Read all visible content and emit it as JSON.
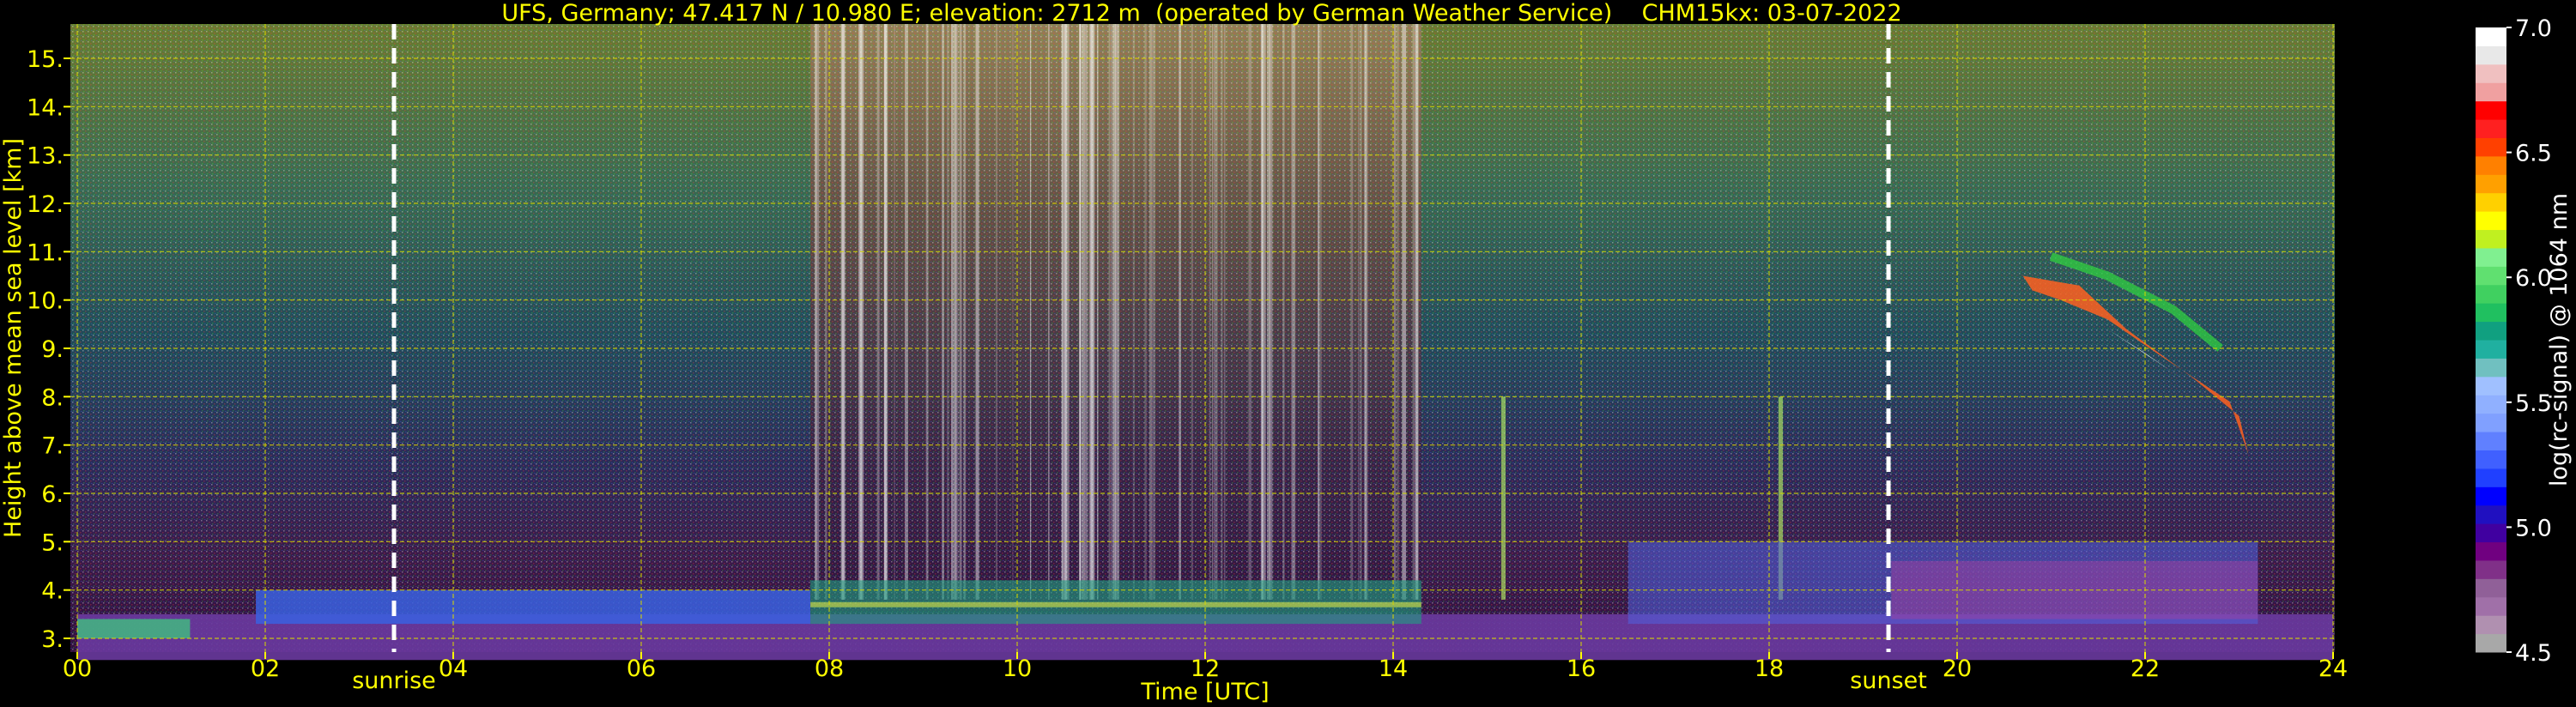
{
  "chart_data": {
    "type": "heatmap",
    "title": "UFS, Germany; 47.417 N / 10.980 E; elevation: 2712 m  (operated by German Weather Service)    CHM15kx: 03-07-2022",
    "xlabel": "Time [UTC]",
    "ylabel": "Height above mean sea level [km]",
    "xlim": [
      0,
      24
    ],
    "ylim": [
      2.8,
      15.7
    ],
    "x_ticks": [
      0,
      2,
      4,
      6,
      8,
      10,
      12,
      14,
      16,
      18,
      20,
      22,
      24
    ],
    "x_tick_labels": [
      "00",
      "02",
      "04",
      "06",
      "08",
      "10",
      "12",
      "14",
      "16",
      "18",
      "20",
      "22",
      "24"
    ],
    "y_ticks": [
      3,
      4,
      5,
      6,
      7,
      8,
      9,
      10,
      11,
      12,
      13,
      14,
      15
    ],
    "y_tick_labels": [
      "3.",
      "4.",
      "5.",
      "6.",
      "7.",
      "8.",
      "9.",
      "10.",
      "11.",
      "12.",
      "13.",
      "14.",
      "15."
    ],
    "grid": true,
    "markers": [
      {
        "label": "sunrise",
        "x": 3.37
      },
      {
        "label": "sunset",
        "x": 19.27
      }
    ],
    "colorbar": {
      "label": "log(rc-signal) @ 1064 nm",
      "range": [
        4.5,
        7.0
      ],
      "ticks": [
        4.5,
        5.0,
        5.5,
        6.0,
        6.5,
        7.0
      ],
      "tick_labels": [
        "4.5",
        "5.0",
        "5.5",
        "6.0",
        "6.5",
        "7.0"
      ],
      "colors": [
        "#a8a8a8",
        "#b090b0",
        "#a070a8",
        "#906098",
        "#803088",
        "#700080",
        "#4000a0",
        "#2010c0",
        "#0000ff",
        "#2040ff",
        "#4060ff",
        "#6080ff",
        "#80a0ff",
        "#90b0ff",
        "#a0c0ff",
        "#70c0c0",
        "#20b0a0",
        "#10a080",
        "#20c060",
        "#40d060",
        "#60e070",
        "#80f090",
        "#c0f020",
        "#ffff00",
        "#ffd000",
        "#ffa000",
        "#ff8000",
        "#ff4000",
        "#ff2020",
        "#ff0000",
        "#f0a0a0",
        "#f0c0c0",
        "#e8e8e8",
        "#ffffff"
      ]
    }
  }
}
